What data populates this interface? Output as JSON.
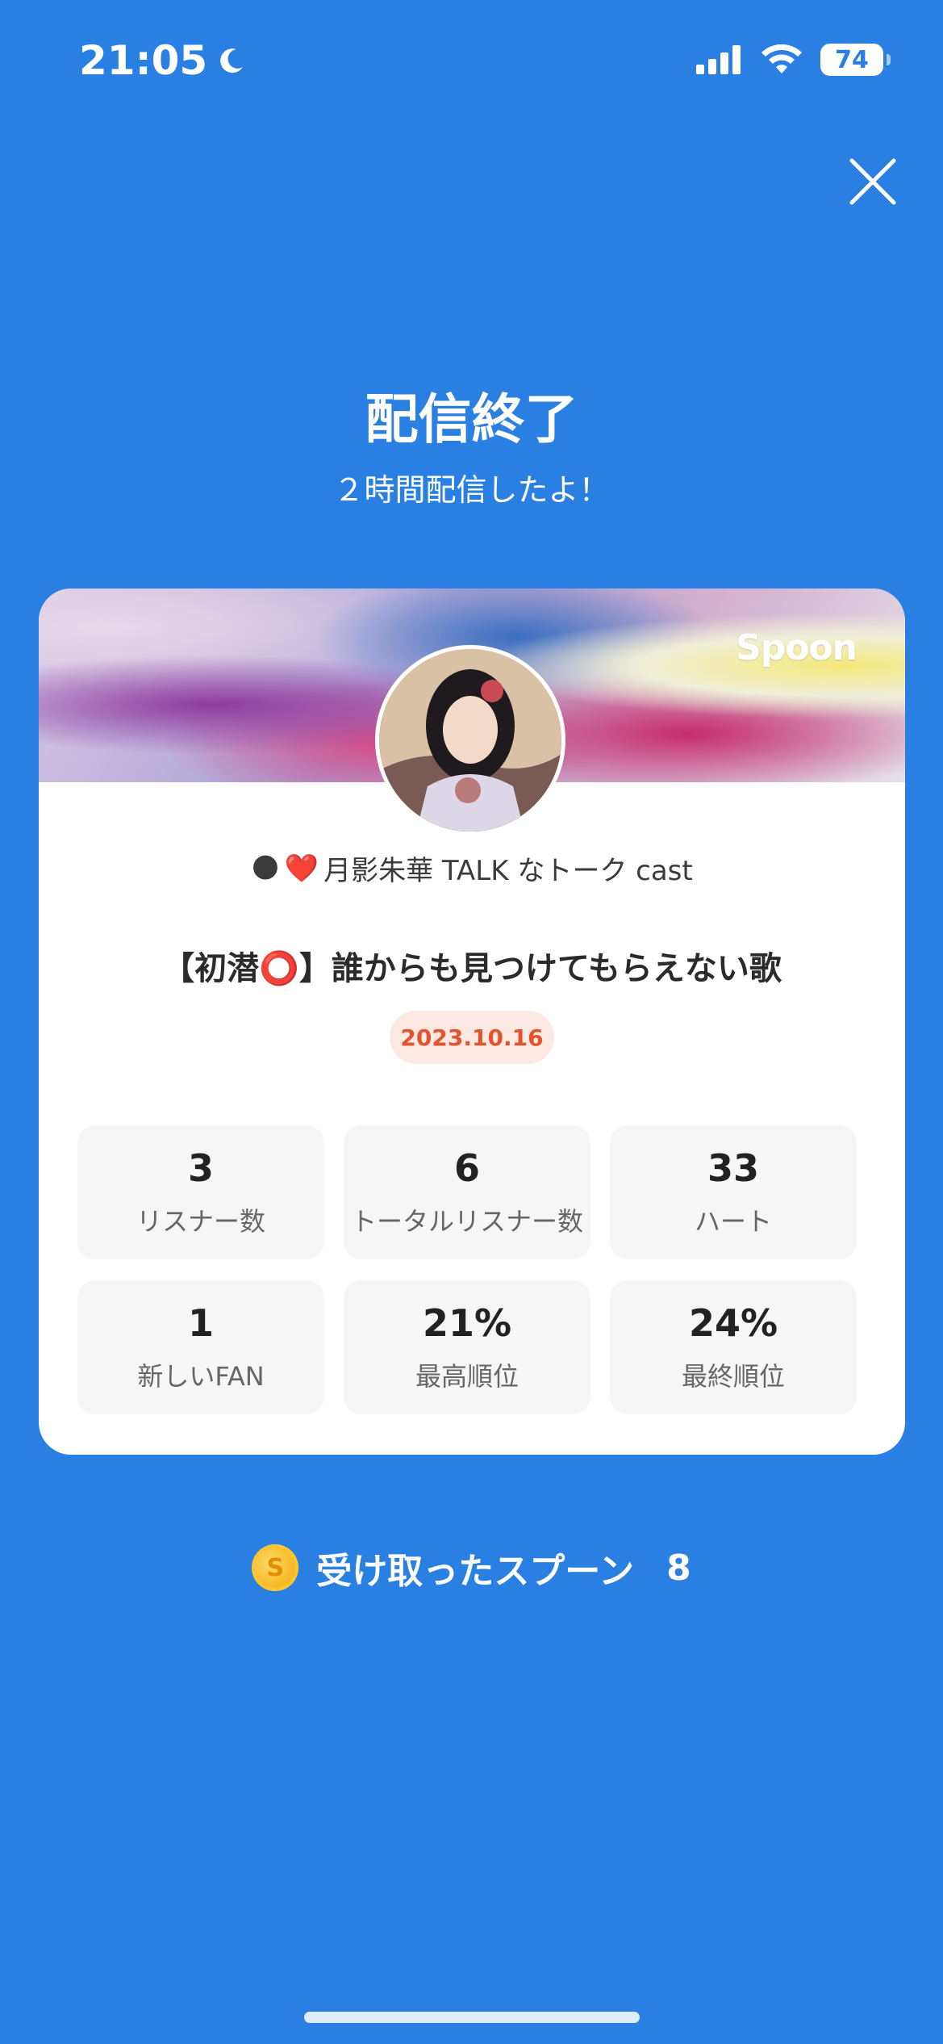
{
  "status_bar": {
    "time": "21:05",
    "battery": "74"
  },
  "header": {
    "title": "配信終了",
    "subtitle": "２時間配信したよ！"
  },
  "card": {
    "brand": "Spoon",
    "host_line": "月影朱華 TALK なトーク cast",
    "cast_title": "【初潜⭕】誰からも見つけてもらえない歌",
    "date": "2023.10.16",
    "stats": [
      {
        "value": "3",
        "label": "リスナー数"
      },
      {
        "value": "6",
        "label": "トータルリスナー数"
      },
      {
        "value": "33",
        "label": "ハート"
      },
      {
        "value": "1",
        "label": "新しいFAN"
      },
      {
        "value": "21%",
        "label": "最高順位"
      },
      {
        "value": "24%",
        "label": "最終順位"
      }
    ]
  },
  "spoons": {
    "label": "受け取ったスプーン",
    "count": "8"
  },
  "colors": {
    "background": "#2a7fe2",
    "date_badge_text": "#e5532c",
    "date_badge_bg": "#fde8e3"
  },
  "icons": {
    "close": "close-icon",
    "moon": "moon-icon",
    "coin": "coin-icon"
  }
}
